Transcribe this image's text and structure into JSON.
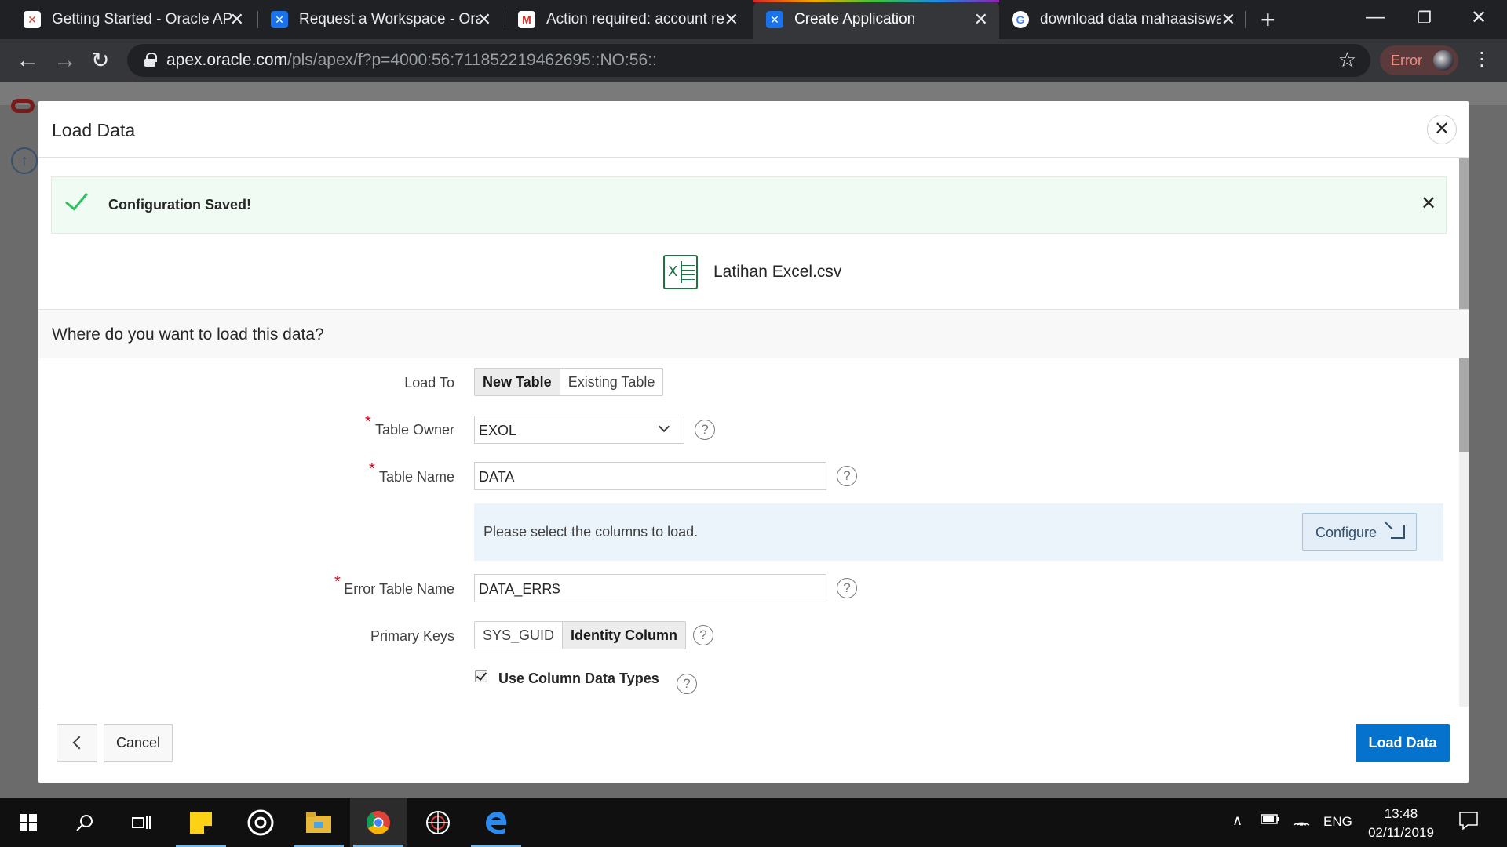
{
  "browser": {
    "tabs": [
      {
        "title": "Getting Started - Oracle API",
        "icon": "apex-logo-icon"
      },
      {
        "title": "Request a Workspace - Oracle",
        "icon": "apex-logo-icon"
      },
      {
        "title": "Action required: account re",
        "icon": "gmail-icon"
      },
      {
        "title": "Create Application",
        "icon": "apex-logo-icon",
        "active": true
      },
      {
        "title": "download data mahaasiswa",
        "icon": "google-icon"
      }
    ],
    "url_host": "apex.oracle.com",
    "url_path": "/pls/apex/f?p=4000:56:711852219462695::NO:56::",
    "profile_status": "Error"
  },
  "modal": {
    "title": "Load Data",
    "alert": "Configuration Saved!",
    "file_name": "Latihan Excel.csv",
    "section_title": "Where do you want to load this data?",
    "load_to": {
      "label": "Load To",
      "options": [
        "New Table",
        "Existing Table"
      ],
      "selected": "New Table"
    },
    "table_owner": {
      "label": "Table Owner",
      "value": "EXOL"
    },
    "table_name": {
      "label": "Table Name",
      "value": "DATA"
    },
    "columns_info": "Please select the columns to load.",
    "configure_label": "Configure",
    "error_table_name": {
      "label": "Error Table Name",
      "value": "DATA_ERR$"
    },
    "primary_keys": {
      "label": "Primary Keys",
      "options": [
        "SYS_GUID",
        "Identity Column"
      ],
      "selected": "Identity Column"
    },
    "use_column_data_types": {
      "label": "Use Column Data Types",
      "checked": true
    },
    "cancel_label": "Cancel",
    "load_label": "Load Data"
  },
  "taskbar": {
    "language": "ENG",
    "time": "13:48",
    "date": "02/11/2019"
  }
}
